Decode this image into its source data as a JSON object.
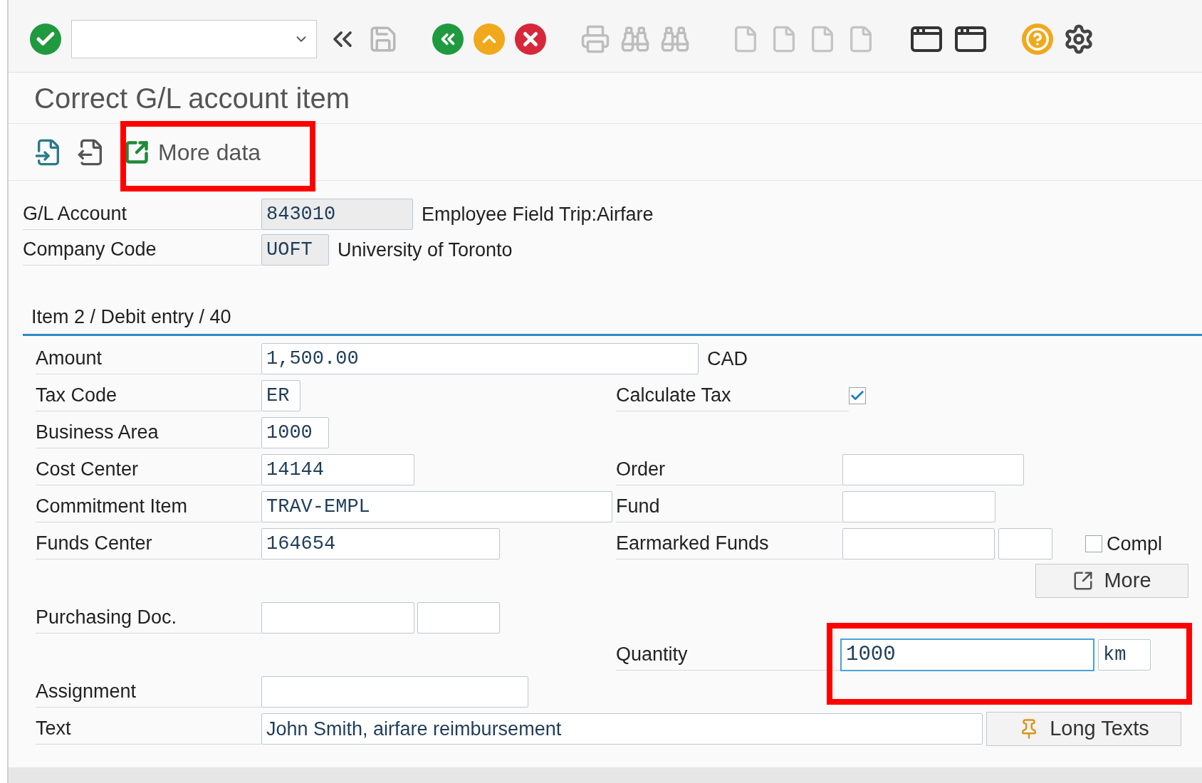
{
  "title": "Correct G/L account item",
  "app_toolbar": {
    "more_data": {
      "label": "More data",
      "highlighted": true
    }
  },
  "header_fields": [
    {
      "label": "G/L Account",
      "value": "843010",
      "description": "Employee Field Trip:Airfare"
    },
    {
      "label": "Company Code",
      "value": "UOFT",
      "description": "University of Toronto"
    }
  ],
  "section": {
    "title": "Item 2 / Debit entry / 40"
  },
  "fields": {
    "amount": {
      "label": "Amount",
      "value": "1,500.00",
      "currency": "CAD"
    },
    "tax_code": {
      "label": "Tax Code",
      "value": "ER"
    },
    "calculate_tax": {
      "label": "Calculate Tax",
      "checked": true
    },
    "business_area": {
      "label": "Business Area",
      "value": "1000"
    },
    "cost_center": {
      "label": "Cost Center",
      "value": "14144"
    },
    "order": {
      "label": "Order"
    },
    "commitment_item": {
      "label": "Commitment Item",
      "value": "TRAV-EMPL"
    },
    "fund": {
      "label": "Fund"
    },
    "funds_center": {
      "label": "Funds Center",
      "value": "164654"
    },
    "earmarked_funds": {
      "label": "Earmarked Funds"
    },
    "compl": {
      "label": "Compl",
      "checked": false
    },
    "more_button": {
      "label": "More"
    },
    "purchasing_doc": {
      "label": "Purchasing Doc."
    },
    "quantity": {
      "label": "Quantity",
      "value": "1000",
      "unit": "km",
      "highlighted": true
    },
    "assignment": {
      "label": "Assignment"
    },
    "text": {
      "label": "Text",
      "value": "John Smith, airfare reimbursement"
    },
    "long_texts": {
      "label": "Long Texts"
    }
  }
}
